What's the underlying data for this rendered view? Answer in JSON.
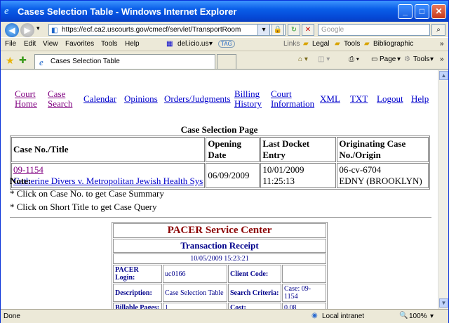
{
  "window": {
    "title": "Cases Selection Table - Windows Internet Explorer"
  },
  "address": {
    "url": "https://ecf.ca2.uscourts.gov/cmecf/servlet/TransportRoom",
    "search_placeholder": "Google"
  },
  "menu": {
    "file": "File",
    "edit": "Edit",
    "view": "View",
    "favorites": "Favorites",
    "tools": "Tools",
    "help": "Help",
    "delicious": "del.icio.us",
    "tag": "TAG"
  },
  "links_bar": {
    "label": "Links",
    "items": [
      "Legal",
      "Tools",
      "Bibliographic"
    ]
  },
  "tab": {
    "title": "Cases Selection Table"
  },
  "toolbar": {
    "page": "Page",
    "tools": "Tools"
  },
  "nav": [
    {
      "line1": "Court",
      "line2": "Home"
    },
    {
      "line1": "Case",
      "line2": "Search"
    },
    {
      "line1": "Calendar",
      "line2": ""
    },
    {
      "line1": "Opinions",
      "line2": ""
    },
    {
      "line1": "Orders/Judgments",
      "line2": ""
    },
    {
      "line1": "Billing",
      "line2": "History"
    },
    {
      "line1": "Court",
      "line2": "Information"
    },
    {
      "line1": "XML",
      "line2": ""
    },
    {
      "line1": "TXT",
      "line2": ""
    },
    {
      "line1": "Logout",
      "line2": ""
    },
    {
      "line1": "Help",
      "line2": ""
    }
  ],
  "page": {
    "caption": "Case Selection Page",
    "columns": [
      "Case No./Title",
      "Opening Date",
      "Last Docket Entry",
      "Originating Case No./Origin"
    ],
    "row": {
      "case_no": "09-1154",
      "title": "Catherine Divers v. Metropolitan Jewish Health Sys",
      "opening_date": "06/09/2009",
      "last_docket": "10/01/2009 11:25:13",
      "orig_case": "06-cv-6704",
      "origin": "EDNY (BROOKLYN)"
    },
    "note_title": "Note:",
    "notes": [
      "* Click on Case No. to get Case Summary",
      "* Click on Short Title to get Case Query"
    ]
  },
  "receipt": {
    "header": "PACER Service Center",
    "subheader": "Transaction Receipt",
    "timestamp": "10/05/2009 15:23:21",
    "login_label": "PACER Login:",
    "login": "uc0166",
    "client_label": "Client Code:",
    "client": "",
    "desc_label": "Description:",
    "desc": "Case Selection Table",
    "criteria_label": "Search Criteria:",
    "criteria": "Case: 09-1154",
    "pages_label": "Billable Pages:",
    "pages": "1",
    "cost_label": "Cost:",
    "cost": "0.08"
  },
  "status": {
    "left": "Done",
    "zone": "Local intranet",
    "zoom": "100%"
  },
  "colors": {
    "link": "#0000cc",
    "visited": "#800080",
    "receipt_title": "#8b0000",
    "receipt_text": "#00008b"
  }
}
